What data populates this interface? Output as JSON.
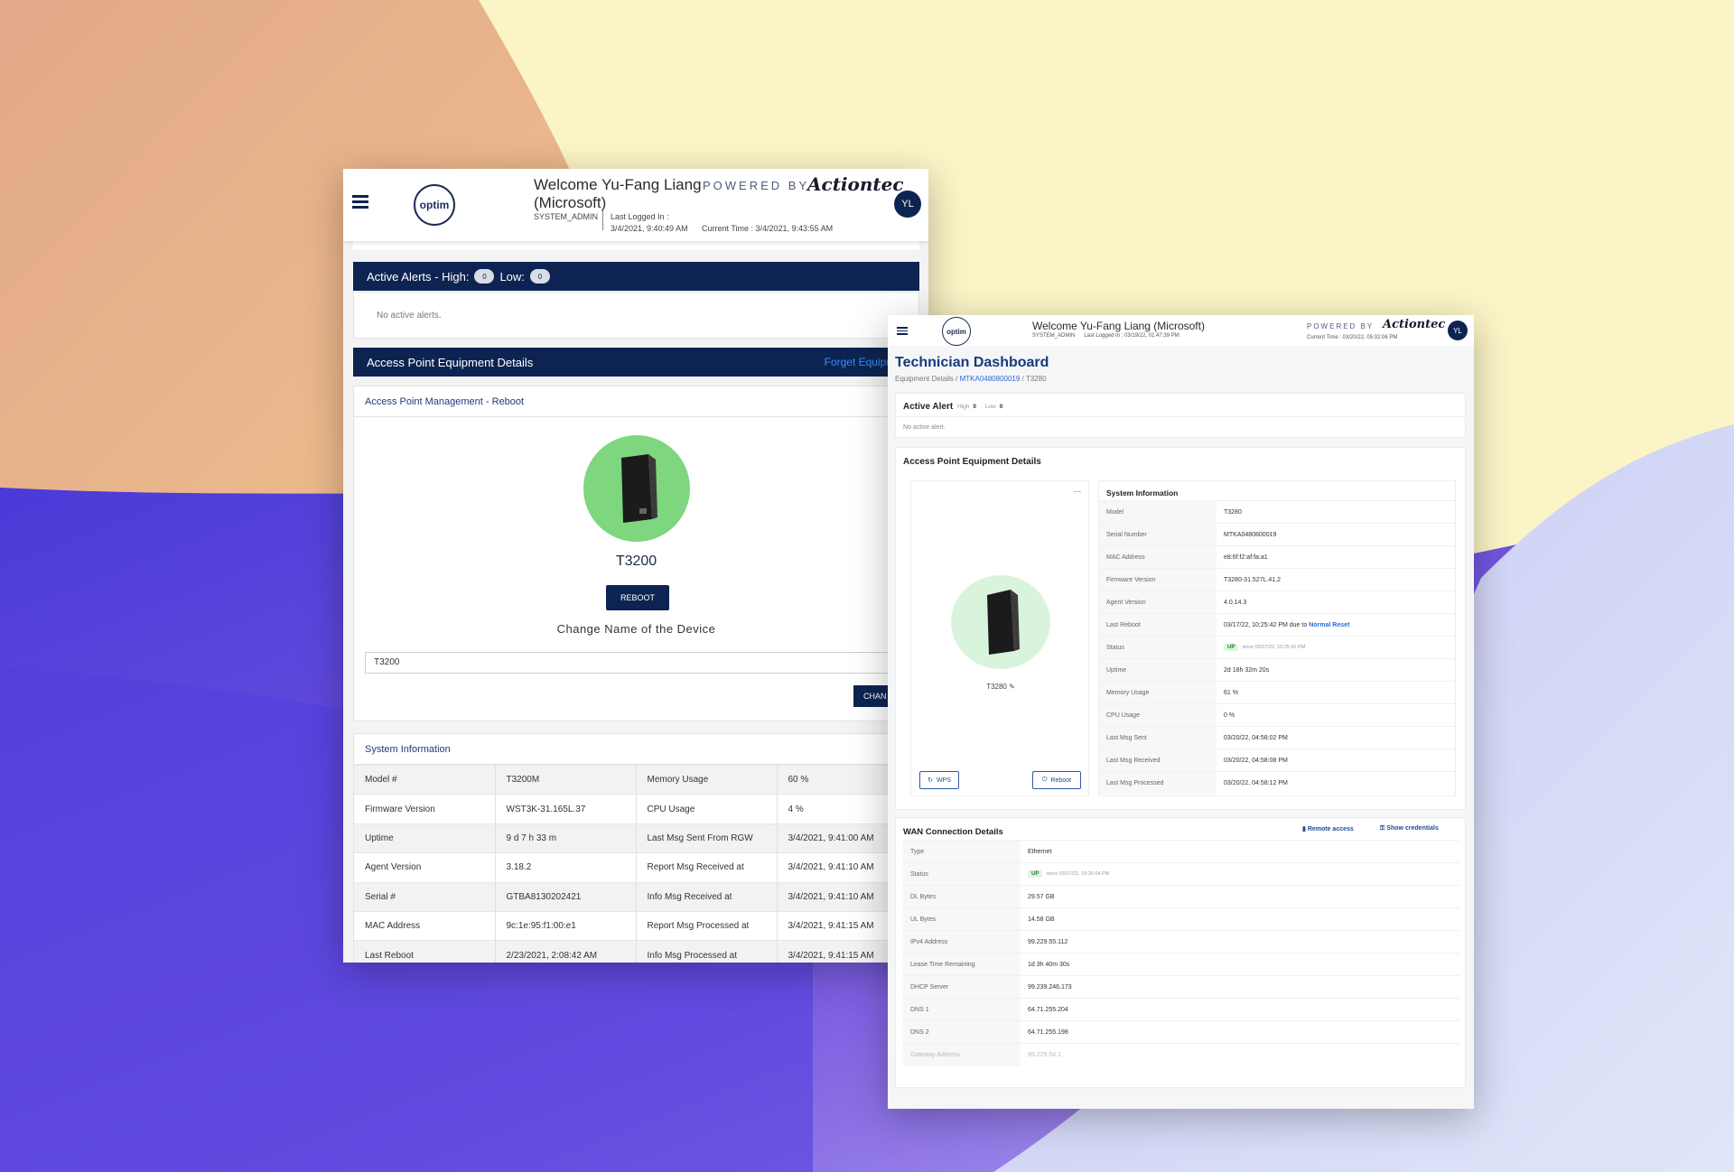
{
  "window1": {
    "header": {
      "logo": "optim",
      "welcome": "Welcome Yu-Fang Liang (Microsoft)",
      "powered_by": "POWERED BY",
      "brand": "Actiontec",
      "role": "SYSTEM_ADMIN",
      "last_logged_label": "Last Logged In :",
      "last_logged_value": "3/4/2021, 9:40:49 AM",
      "current_time": "Current Time : 3/4/2021, 9:43:55 AM",
      "avatar": "YL"
    },
    "alerts": {
      "label": "Active Alerts - High:",
      "high": "0",
      "low_label": "Low:",
      "low": "0",
      "empty": "No active alerts."
    },
    "ap_details": {
      "title": "Access Point Equipment Details",
      "forget": "Forget Equipme",
      "management_title": "Access Point Management - Reboot",
      "device_name": "T3200",
      "reboot": "REBOOT",
      "change_name_label": "Change Name of the Device",
      "name_input_value": "T3200",
      "change_button": "CHAN"
    },
    "system_info": {
      "title": "System Information",
      "rows": [
        [
          "Model #",
          "T3200M",
          "Memory Usage",
          "60 %"
        ],
        [
          "Firmware Version",
          "WST3K-31.165L.37",
          "CPU Usage",
          "4 %"
        ],
        [
          "Uptime",
          "9 d 7 h 33 m",
          "Last Msg Sent From RGW",
          "3/4/2021, 9:41:00 AM"
        ],
        [
          "Agent Version",
          "3.18.2",
          "Report Msg Received at",
          "3/4/2021, 9:41:10 AM"
        ],
        [
          "Serial #",
          "GTBA8130202421",
          "Info Msg Received at",
          "3/4/2021, 9:41:10 AM"
        ],
        [
          "MAC Address",
          "9c:1e:95:f1:00:e1",
          "Report Msg Processed at",
          "3/4/2021, 9:41:15 AM"
        ],
        [
          "Last Reboot",
          "2/23/2021, 2:08:42 AM",
          "Info Msg Processed at",
          "3/4/2021, 9:41:15 AM"
        ]
      ]
    }
  },
  "window2": {
    "header": {
      "logo": "optim",
      "welcome": "Welcome Yu-Fang Liang (Microsoft)",
      "role": "SYSTEM_ADMIN",
      "last_logged": "Last Logged In : 03/19/22, 01:47:39 PM",
      "powered_by": "POWERED BY",
      "brand": "Actiontec",
      "current_time": "Current Time : 03/20/22, 05:02:06 PM",
      "avatar": "YL"
    },
    "title": "Technician Dashboard",
    "breadcrumb": {
      "root": "Equipment Details",
      "serial": "MTKA0480800019",
      "model": "T3280"
    },
    "alert": {
      "title": "Active Alert",
      "high_label": "High",
      "high": "0",
      "low_label": "Low",
      "low": "0",
      "empty": "No active alert."
    },
    "ap_details": {
      "title": "Access Point Equipment Details",
      "more": "...",
      "device_name": "T3280",
      "wps": "WPS",
      "reboot": "Reboot",
      "sys_title": "System Information",
      "model_label": "Model",
      "model": "T3280",
      "serial_label": "Serial Number",
      "serial": "MTKA0480800019",
      "mac_label": "MAC Address",
      "mac": "e8:6f:f2:af:fa:a1",
      "fw_label": "Firmware Version",
      "fw": "T3280-31.527L.41.2",
      "agent_label": "Agent Version",
      "agent": "4.0.14.3",
      "reboot_label": "Last Reboot",
      "reboot_value": "03/17/22, 10:25:42 PM due to",
      "reboot_reason": "Normal Reset",
      "status_label": "Status",
      "status": "UP",
      "status_since": "since 03/17/22, 10:25:42 PM",
      "uptime_label": "Uptime",
      "uptime": "2d 18h 32m 20s",
      "mem_label": "Memory Usage",
      "mem": "61 %",
      "cpu_label": "CPU Usage",
      "cpu": "0 %",
      "sent_label": "Last Msg Sent",
      "sent": "03/20/22, 04:58:02 PM",
      "recv_label": "Last Msg Received",
      "recv": "03/20/22, 04:58:08 PM",
      "proc_label": "Last Msg Processed",
      "proc": "03/20/22, 04:58:12 PM"
    },
    "wan": {
      "title": "WAN Connection Details",
      "remote": "Remote access",
      "creds": "Show credentials",
      "type_label": "Type",
      "type": "Ethernet",
      "status_label": "Status",
      "status": "UP",
      "status_since": "since 03/17/22, 10:26:04 PM",
      "dl_label": "DL Bytes",
      "dl": "29.57 GB",
      "ul_label": "UL Bytes",
      "ul": "14.58 GB",
      "ipv4_label": "IPv4 Address",
      "ipv4": "99.229.55.112",
      "lease_label": "Lease Time Remaining",
      "lease": "1d 3h 40m 30s",
      "dhcp_label": "DHCP Server",
      "dhcp": "99.239.246.173",
      "dns1_label": "DNS 1",
      "dns1": "64.71.255.204",
      "dns2_label": "DNS 2",
      "dns2": "64.71.255.198",
      "gw_label": "Gateway Address",
      "gw": "99.229.54.1"
    }
  },
  "colors": {
    "navy": "#0d2452",
    "link_blue": "#2b6ad8",
    "device_green": "#7ed67e",
    "device_green_light": "#d9f4dc"
  }
}
